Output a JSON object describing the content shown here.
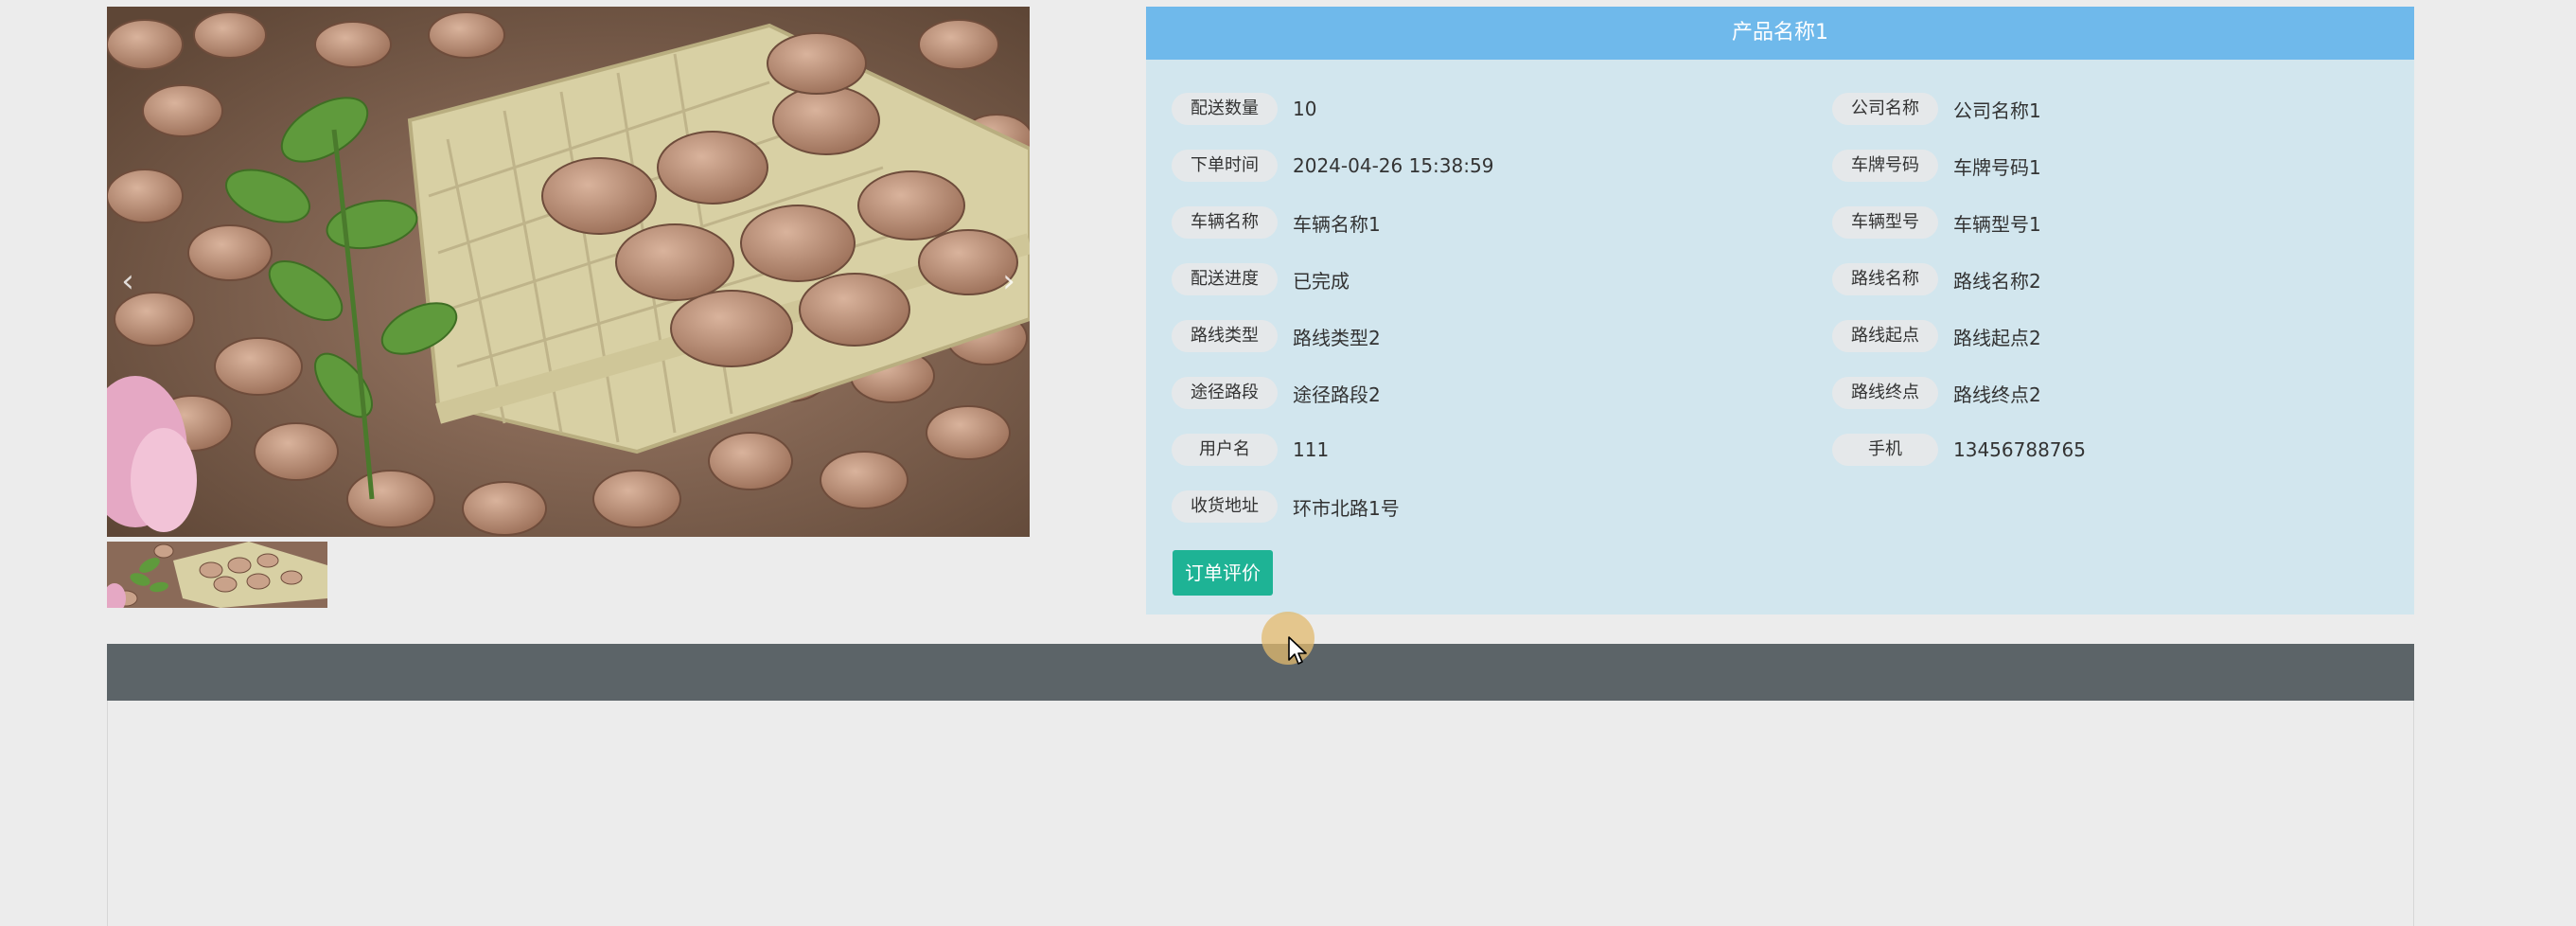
{
  "gallery": {
    "main_image_alt": "beans-photo",
    "thumbnail_alt": "beans-thumbnail",
    "prev_icon": "chevron-left-icon",
    "next_icon": "chevron-right-icon"
  },
  "detail": {
    "title": "产品名称1",
    "fields_left": [
      {
        "label": "配送数量",
        "value": "10"
      },
      {
        "label": "下单时间",
        "value": "2024-04-26 15:38:59"
      },
      {
        "label": "车辆名称",
        "value": "车辆名称1"
      },
      {
        "label": "配送进度",
        "value": "已完成"
      },
      {
        "label": "路线类型",
        "value": "路线类型2"
      },
      {
        "label": "途径路段",
        "value": "途径路段2"
      },
      {
        "label": "用户名",
        "value": "111"
      },
      {
        "label": "收货地址",
        "value": "环市北路1号"
      }
    ],
    "fields_right": [
      {
        "label": "公司名称",
        "value": "公司名称1"
      },
      {
        "label": "车牌号码",
        "value": "车牌号码1"
      },
      {
        "label": "车辆型号",
        "value": "车辆型号1"
      },
      {
        "label": "路线名称",
        "value": "路线名称2"
      },
      {
        "label": "路线起点",
        "value": "路线起点2"
      },
      {
        "label": "路线终点",
        "value": "路线终点2"
      },
      {
        "label": "手机",
        "value": "13456788765"
      }
    ],
    "review_button": "订单评价"
  },
  "colors": {
    "header": "#6fb9eb",
    "panel": "#d2e6ee",
    "button": "#1eb395",
    "section_bar": "#5c6468",
    "page": "#ececec"
  }
}
